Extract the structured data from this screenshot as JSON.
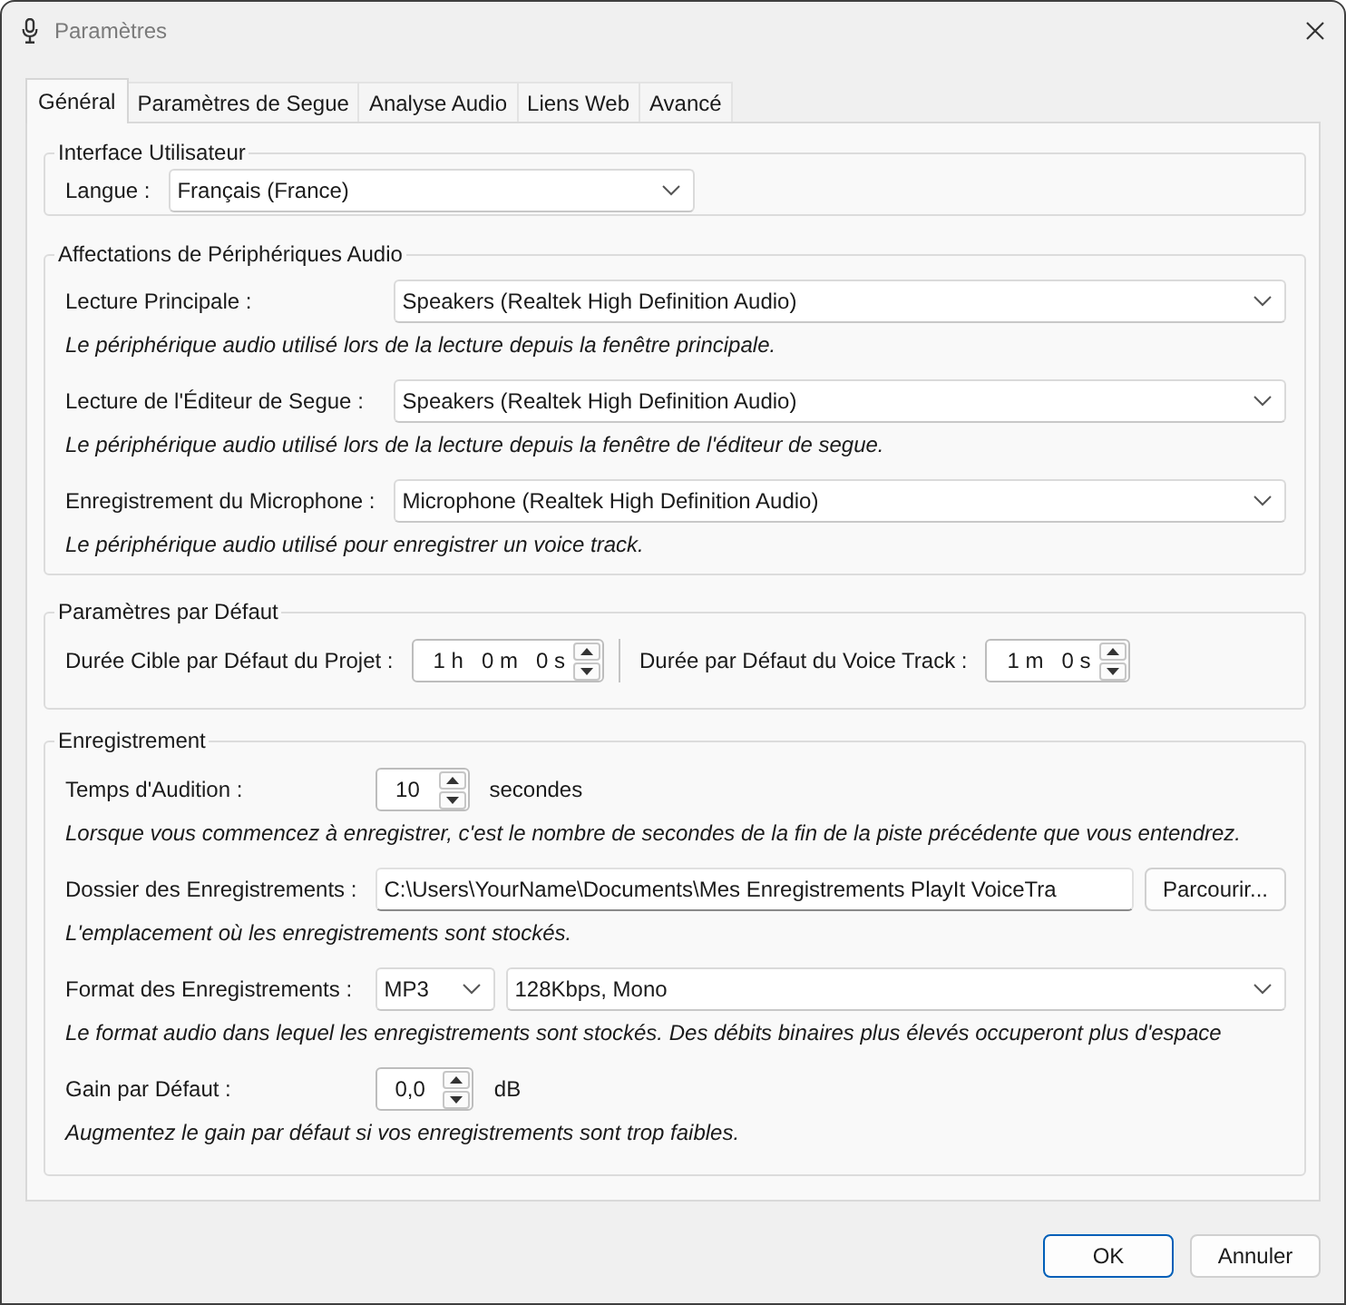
{
  "window": {
    "title": "Paramètres"
  },
  "tabs": [
    {
      "label": "Général",
      "selected": true
    },
    {
      "label": "Paramètres de Segue",
      "selected": false
    },
    {
      "label": "Analyse Audio",
      "selected": false
    },
    {
      "label": "Liens Web",
      "selected": false
    },
    {
      "label": "Avancé",
      "selected": false
    }
  ],
  "sections": [
    {
      "kind": "form",
      "title": "Interface Utilisateur",
      "rows": [
        {
          "label": "Langue :",
          "controls": [
            {
              "kind": "fixed-dropdown",
              "value": "Français (France)"
            }
          ]
        }
      ]
    },
    {
      "kind": "form",
      "title": "Affectations de Périphériques Audio",
      "rows": [
        {
          "label": "Lecture Principale :",
          "controls": [
            {
              "kind": "dropdown",
              "value": "Speakers (Realtek High Definition Audio)"
            }
          ],
          "description": "Le périphérique audio utilisé lors de la lecture depuis la fenêtre principale."
        },
        {
          "label": "Lecture de l'Éditeur de Segue :",
          "controls": [
            {
              "kind": "dropdown",
              "value": "Speakers (Realtek High Definition Audio)"
            }
          ],
          "description": "Le périphérique audio utilisé lors de la lecture depuis la fenêtre de l'éditeur de segue."
        },
        {
          "label": "Enregistrement du Microphone :",
          "controls": [
            {
              "kind": "dropdown",
              "value": "Microphone (Realtek High Definition Audio)"
            }
          ],
          "description": "Le périphérique audio utilisé pour enregistrer un voice track."
        }
      ]
    },
    {
      "kind": "inline",
      "title": "Paramètres par Défaut",
      "rows": [
        {
          "label": "Durée Cible par Défaut du Projet :",
          "controls": [
            {
              "kind": "duration",
              "parts": [
                "1 h",
                "0 m",
                "0 s"
              ]
            }
          ]
        },
        {
          "label": "Durée par Défaut du Voice Track :",
          "controls": [
            {
              "kind": "duration",
              "parts": [
                "1 m",
                "0 s"
              ]
            }
          ]
        }
      ]
    },
    {
      "kind": "form",
      "title": "Enregistrement",
      "rows": [
        {
          "label": "Temps d'Audition :",
          "controls": [
            {
              "kind": "spinner",
              "value": "10"
            },
            {
              "kind": "unit",
              "text": "secondes"
            }
          ],
          "description": "Lorsque vous commencez à enregistrer, c'est le nombre de secondes de la fin de la piste précédente que vous entendrez."
        },
        {
          "label": "Dossier des Enregistrements :",
          "controls": [
            {
              "kind": "path",
              "value": "C:\\Users\\YourName\\Documents\\Mes Enregistrements PlayIt VoiceTra"
            },
            {
              "kind": "button",
              "label": "Parcourir..."
            }
          ],
          "description": "L'emplacement où les enregistrements sont stockés."
        },
        {
          "label": "Format des Enregistrements :",
          "controls": [
            {
              "kind": "mini-dropdown",
              "value": "MP3"
            },
            {
              "kind": "dropdown",
              "value": "128Kbps, Mono"
            }
          ],
          "description": "Le format audio dans lequel les enregistrements sont stockés. Des débits binaires plus élevés occuperont plus d'espace"
        },
        {
          "label": "Gain par Défaut :",
          "controls": [
            {
              "kind": "spinner",
              "value": "0,0"
            },
            {
              "kind": "unit",
              "text": "dB"
            }
          ],
          "description": "Augmentez le gain par défaut si vos enregistrements sont trop faibles."
        }
      ]
    }
  ],
  "buttons": [
    {
      "label": "OK",
      "default": true
    },
    {
      "label": "Annuler",
      "default": false
    }
  ]
}
